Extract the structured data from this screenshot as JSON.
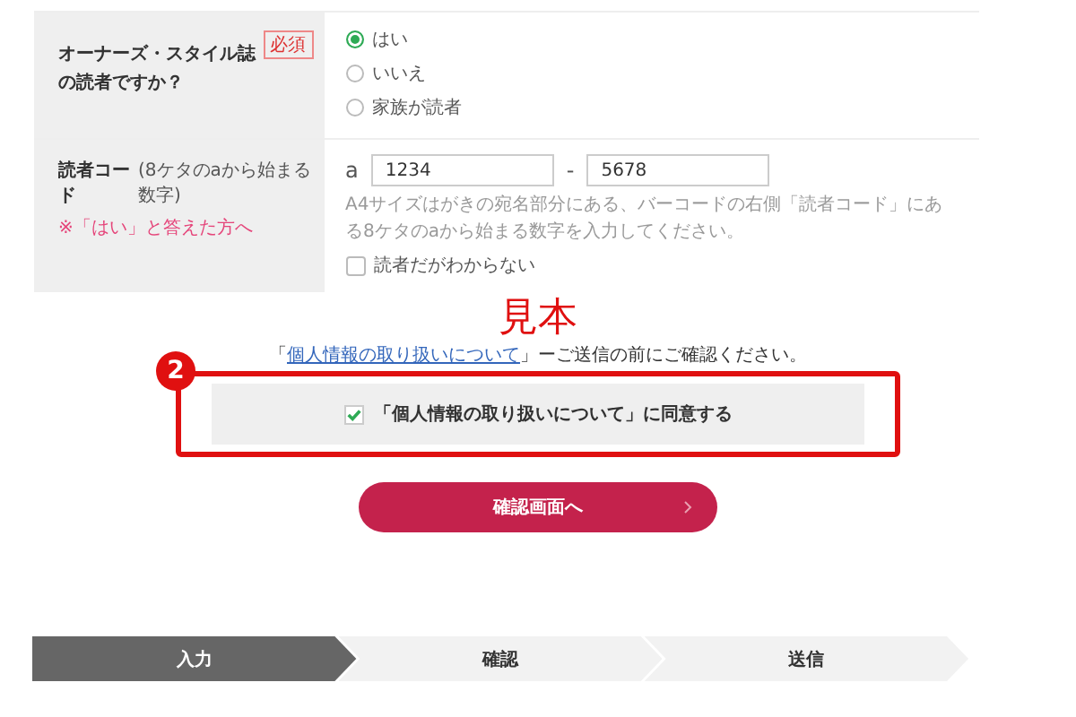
{
  "reader_question": {
    "label": "オーナーズ・スタイル誌の読者ですか？",
    "required_badge": "必須",
    "options": [
      {
        "label": "はい",
        "selected": true
      },
      {
        "label": "いいえ",
        "selected": false
      },
      {
        "label": "家族が読者",
        "selected": false
      }
    ]
  },
  "reader_code": {
    "label": "読者コード",
    "hint": "(8ケタのaから始まる数字)",
    "note": "※「はい」と答えた方へ",
    "prefix": "a",
    "separator": "-",
    "fields": [
      {
        "value": "1234"
      },
      {
        "value": "5678"
      }
    ],
    "help": "A4サイズはがきの宛名部分にある、バーコードの右側「読者コード」にある8ケタのaから始まる数字を入力してください。",
    "unknown_checkbox": {
      "label": "読者だがわからない",
      "checked": false
    }
  },
  "annotation": {
    "sample_label": "見本",
    "step_badge": "2"
  },
  "privacy": {
    "notice_before": "「",
    "link": "個人情報の取り扱いについて",
    "notice_after": "」ーご送信の前にご確認ください。",
    "agree_checkbox": {
      "label": "「個人情報の取り扱いについて」に同意する",
      "checked": true
    }
  },
  "submit_button": "確認画面へ",
  "steps": [
    {
      "label": "入力",
      "selected": true
    },
    {
      "label": "確認",
      "selected": false
    },
    {
      "label": "送信",
      "selected": false
    }
  ]
}
